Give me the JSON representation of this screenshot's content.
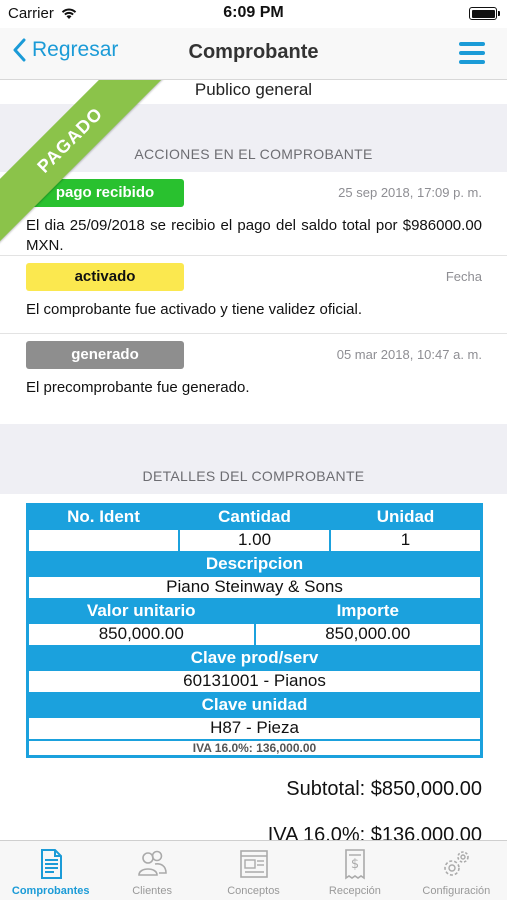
{
  "status": {
    "carrier": "Carrier",
    "time": "6:09 PM"
  },
  "nav": {
    "back_label": "Regresar",
    "title": "Comprobante"
  },
  "client": {
    "name": "Publico general"
  },
  "ribbon": {
    "label": "PAGADO",
    "color": "#8bc34a"
  },
  "actions_section": {
    "title": "ACCIONES EN EL COMPROBANTE",
    "items": [
      {
        "status": "pago recibido",
        "date": "25 sep 2018, 17:09 p. m.",
        "description": "El dia 25/09/2018 se recibio el pago del saldo total por $986000.00 MXN.",
        "color": "#29c12f"
      },
      {
        "status": "activado",
        "date": "Fecha",
        "description": "El comprobante fue activado y tiene validez oficial.",
        "color": "#fbe84f"
      },
      {
        "status": "generado",
        "date": "05 mar 2018, 10:47 a. m.",
        "description": "El precomprobante fue generado.",
        "color": "#8e8e8e"
      }
    ]
  },
  "details_section": {
    "title": "DETALLES DEL COMPROBANTE",
    "headers": {
      "no_ident": "No. Ident",
      "cantidad": "Cantidad",
      "unidad": "Unidad",
      "descripcion": "Descripcion",
      "valor_unitario": "Valor unitario",
      "importe": "Importe",
      "clave_prod": "Clave prod/serv",
      "clave_unidad": "Clave unidad"
    },
    "values": {
      "no_ident": "",
      "cantidad": "1.00",
      "unidad": "1",
      "descripcion": "Piano Steinway & Sons",
      "valor_unitario": "850,000.00",
      "importe": "850,000.00",
      "clave_prod": "60131001 - Pianos",
      "clave_unidad": "H87 - Pieza",
      "iva": "IVA 16.0%: 136,000.00"
    }
  },
  "totals": {
    "subtotal": "Subtotal: $850,000.00",
    "iva": "IVA 16.0%: $136,000.00"
  },
  "tabbar": {
    "items": [
      {
        "label": "Comprobantes",
        "icon": "document-icon",
        "active": true
      },
      {
        "label": "Clientes",
        "icon": "people-icon",
        "active": false
      },
      {
        "label": "Conceptos",
        "icon": "catalog-icon",
        "active": false
      },
      {
        "label": "Recepción",
        "icon": "receipt-icon",
        "active": false
      },
      {
        "label": "Configuración",
        "icon": "gears-icon",
        "active": false
      }
    ]
  },
  "colors": {
    "accent": "#1b9bd7",
    "table": "#1ba1dd",
    "section_bg": "#efeff4"
  }
}
